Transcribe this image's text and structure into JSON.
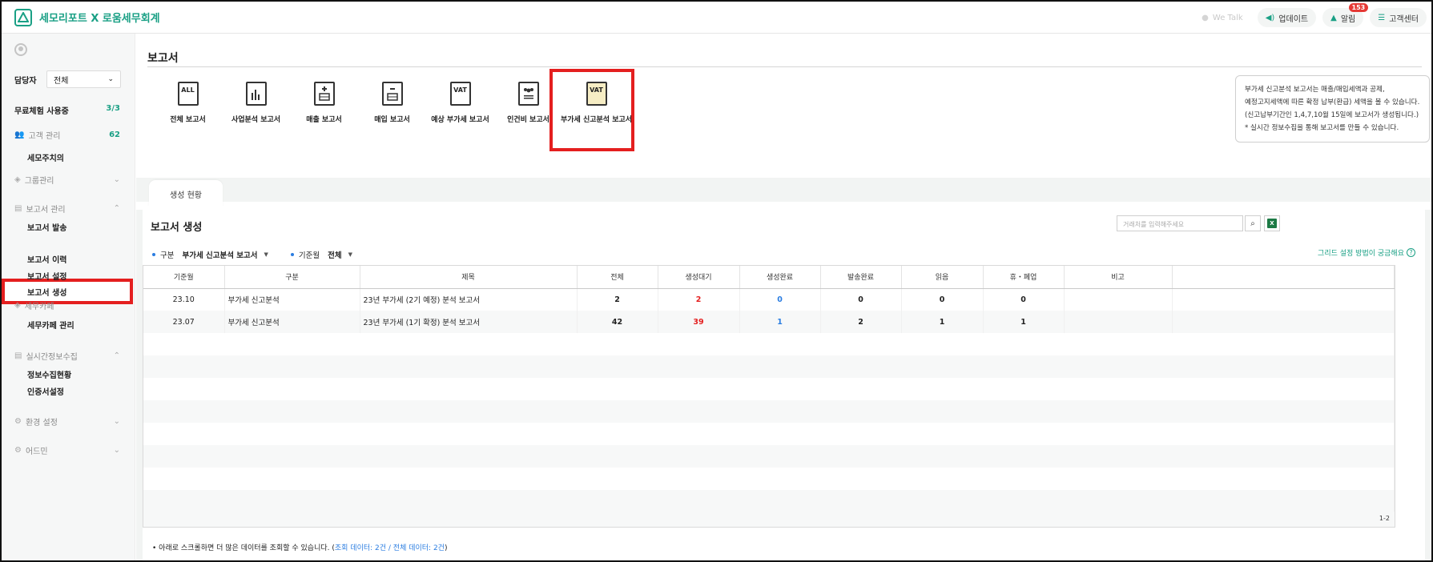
{
  "header": {
    "app_title": "세모리포트 X 로움세무회계",
    "we_talk": "We Talk",
    "update": "업데이트",
    "alarm": "알림",
    "alarm_count": "153",
    "support": "고객센터"
  },
  "sidebar": {
    "manager_label": "담당자",
    "manager_value": "전체",
    "trial_label": "무료체험 사용중",
    "trial_value": "3/3",
    "customer_mgmt": "고객 관리",
    "customer_count": "62",
    "semo_alert": "세모주치의",
    "group_mgmt": "그룹관리",
    "report_mgmt": "보고서 관리",
    "report_items": [
      "보고서 발송",
      "보고서 생성",
      "보고서 이력",
      "보고서 설정"
    ],
    "semu_cafe": "세무카페",
    "semu_cafe_mgmt": "세무카페 관리",
    "realtime": "실시간정보수집",
    "realtime_items": [
      "정보수집현황",
      "인증서설정"
    ],
    "settings": "환경 설정",
    "admin": "어드민"
  },
  "page": {
    "title": "보고서",
    "reports": [
      {
        "icon": "ALL",
        "label": "전체 보고서"
      },
      {
        "icon": "",
        "label": "사업분석 보고서"
      },
      {
        "icon": "",
        "label": "매출 보고서"
      },
      {
        "icon": "",
        "label": "매입 보고서"
      },
      {
        "icon": "VAT",
        "label": "예상 부가세 보고서"
      },
      {
        "icon": "",
        "label": "인건비 보고서"
      },
      {
        "icon": "VAT",
        "label": "부가세 신고분석 보고서"
      }
    ],
    "info_lines": [
      "부가세 신고분석 보고서는 매출/매입세액과 공제,",
      "예정고지세액에 따른 확정 납부(환급) 세액을 볼 수 있습니다.",
      "(신고납부기간인 1,4,7,10월 15일에 보고서가 생성됩니다.)",
      "* 실시간 정보수집을 통해 보고서를 만들 수 있습니다."
    ],
    "tab": "생성 현황"
  },
  "panel": {
    "title": "보고서 생성",
    "search_placeholder": "거래처를 입력해주세요",
    "filter1_label": "구분",
    "filter1_value": "부가세 신고분석 보고서",
    "filter2_label": "기준월",
    "filter2_value": "전체",
    "grid_help": "그리드 설정 방법이 궁금해요",
    "columns": [
      "기준월",
      "구분",
      "제목",
      "전체",
      "생성대기",
      "생성완료",
      "발송완료",
      "읽음",
      "휴・폐업",
      "비고"
    ],
    "rows": [
      [
        "23.10",
        "부가세 신고분석",
        "23년 부가세 (2기 예정) 분석 보고서",
        "2",
        "2",
        "0",
        "0",
        "0",
        "0",
        ""
      ],
      [
        "23.07",
        "부가세 신고분석",
        "23년 부가세 (1기 확정) 분석 보고서",
        "42",
        "39",
        "1",
        "2",
        "1",
        "1",
        ""
      ]
    ],
    "pager": "1-2",
    "note_prefix": "• 아래로 스크롤하면 더 많은 데이터를 조회할 수 있습니다. (",
    "note_link": "조회 데이터: 2건 / 전체 데이터: 2건",
    "note_suffix": ")"
  },
  "colors": {
    "accent": "#1aa085",
    "highlight": "#e41f1f",
    "link": "#2a7de1"
  }
}
